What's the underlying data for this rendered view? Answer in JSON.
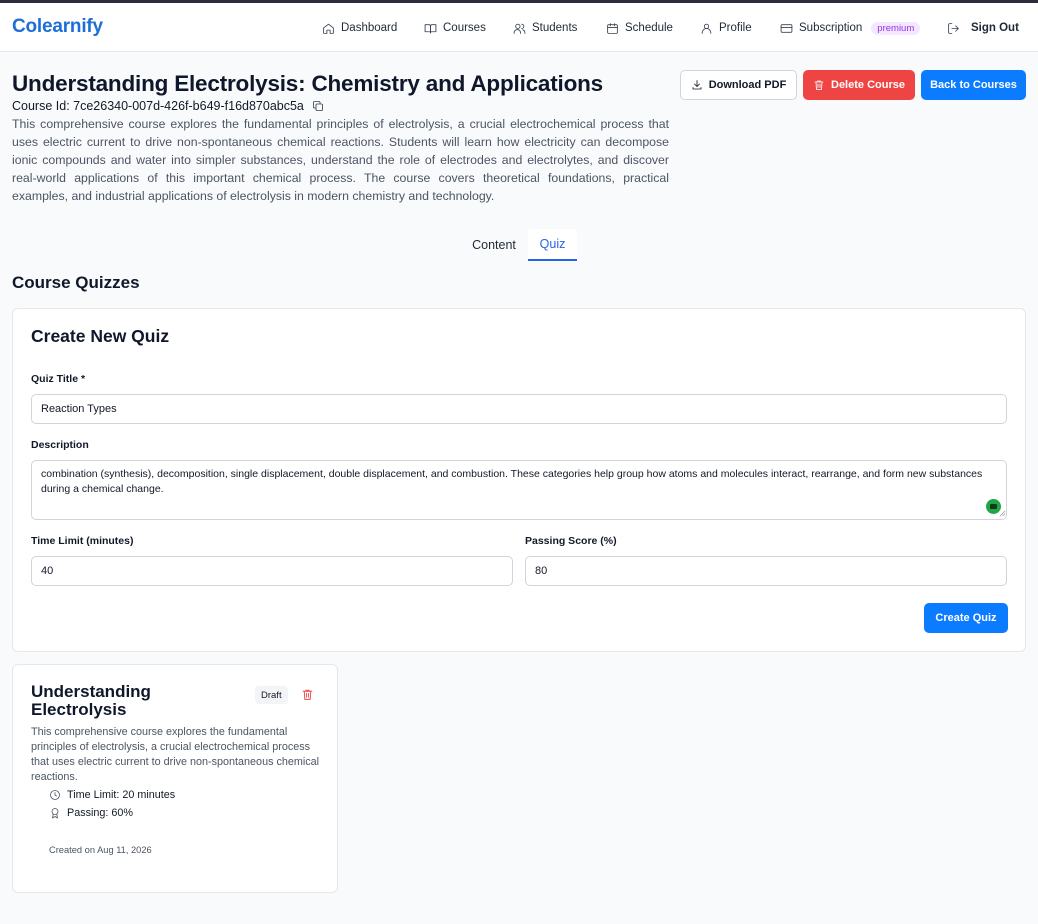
{
  "nav": {
    "brand": "Colearnify",
    "items": [
      {
        "label": "Dashboard",
        "icon": "home-icon"
      },
      {
        "label": "Courses",
        "icon": "book-icon"
      },
      {
        "label": "Students",
        "icon": "users-icon"
      },
      {
        "label": "Schedule",
        "icon": "calendar-icon"
      },
      {
        "label": "Profile",
        "icon": "user-icon"
      },
      {
        "label": "Subscription",
        "icon": "credit-card-icon",
        "badge": "premium"
      }
    ],
    "sign_out": "Sign Out"
  },
  "course": {
    "title": "Understanding Electrolysis: Chemistry and Applications",
    "id_label": "Course Id: 7ce26340-007d-426f-b649-f16d870abc5a",
    "description": "This comprehensive course explores the fundamental principles of electrolysis, a crucial electrochemical process that uses electric current to drive non-spontaneous chemical reactions. Students will learn how electricity can decompose ionic compounds and water into simpler substances, understand the role of electrodes and electrolytes, and discover real-world applications of this important chemical process. The course covers theoretical foundations, practical examples, and industrial applications of electrolysis in modern chemistry and technology."
  },
  "actions": {
    "download_pdf": "Download PDF",
    "delete_course": "Delete Course",
    "back": "Back to Courses"
  },
  "tabs": [
    {
      "label": "Content",
      "active": false
    },
    {
      "label": "Quiz",
      "active": true
    }
  ],
  "quizzes_heading": "Course Quizzes",
  "create_form": {
    "heading": "Create New Quiz",
    "title_label": "Quiz Title *",
    "title_value": "Reaction Types",
    "description_label": "Description",
    "description_value": "combination (synthesis), decomposition, single displacement, double displacement, and combustion. These categories help group how atoms and molecules interact, rearrange, and form new substances during a chemical change.",
    "time_limit_label": "Time Limit (minutes)",
    "time_limit_value": "40",
    "passing_label": "Passing Score (%)",
    "passing_value": "80",
    "submit": "Create Quiz"
  },
  "quiz_cards": [
    {
      "title": "Understanding Electrolysis",
      "status": "Draft",
      "description": "This comprehensive course explores the fundamental principles of electrolysis, a crucial electrochemical process that uses electric current to drive non-spontaneous chemical reactions.",
      "time_limit": "Time Limit: 20 minutes",
      "passing": "Passing: 60%",
      "created": "Created on Aug 11, 2026"
    }
  ],
  "colors": {
    "brand": "#1d6fd6",
    "primary": "#0b7cff",
    "danger": "#ef4444",
    "premium": "#9333ea"
  }
}
